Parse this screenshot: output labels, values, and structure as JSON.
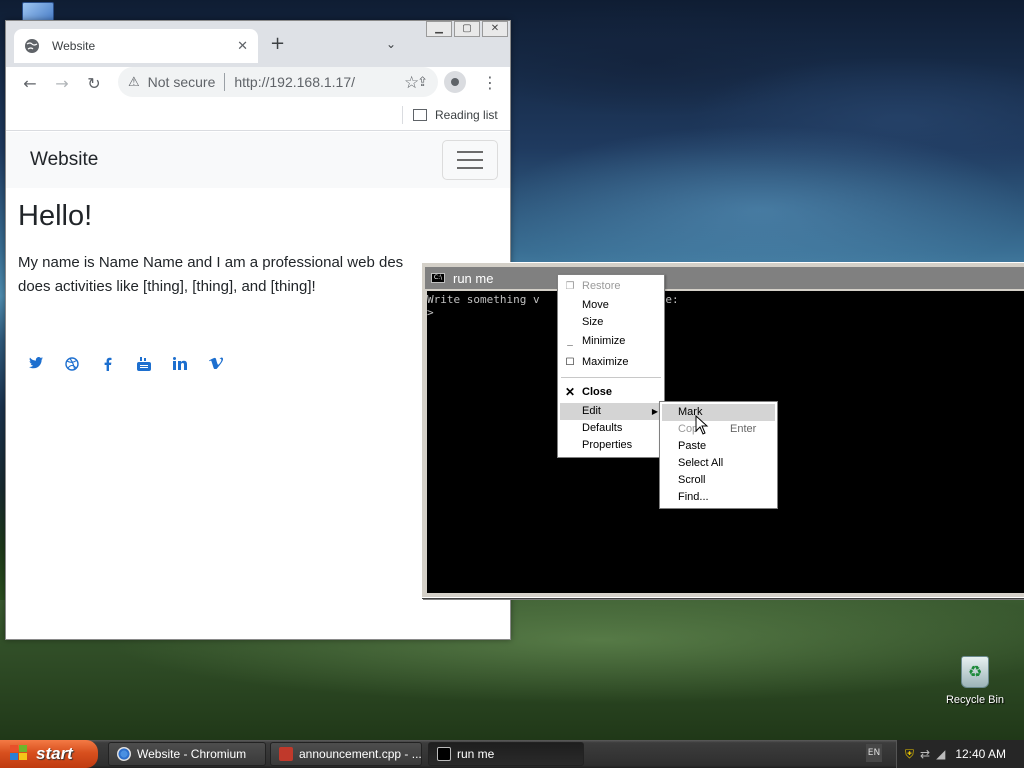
{
  "browser": {
    "tab_title": "Website",
    "security_label": "Not secure",
    "url": "http://192.168.1.17/",
    "reading_list_label": "Reading list"
  },
  "website": {
    "brand": "Website",
    "heading": "Hello!",
    "bio_line1": "My name is Name Name and I am a professional web des",
    "bio_line2": "does activities like [thing], [thing], and [thing]!",
    "social_icons": [
      "twitter-icon",
      "dribbble-icon",
      "facebook-icon",
      "youtube-icon",
      "linkedin-icon",
      "vimeo-icon"
    ]
  },
  "console": {
    "title": "run me",
    "line1": "Write something v        d witty here:",
    "line2": ">"
  },
  "system_menu": {
    "items": [
      {
        "label": "Restore",
        "disabled": true
      },
      {
        "label": "Move"
      },
      {
        "label": "Size"
      },
      {
        "label": "Minimize"
      },
      {
        "label": "Maximize"
      },
      {
        "label": "Close",
        "bold": true
      },
      {
        "label": "Edit",
        "selected": true,
        "submenu": true
      },
      {
        "label": "Defaults"
      },
      {
        "label": "Properties"
      }
    ]
  },
  "edit_submenu": {
    "items": [
      {
        "label": "Mark",
        "selected": true
      },
      {
        "label": "Copy",
        "shortcut": "Enter",
        "disabled": true
      },
      {
        "label": "Paste"
      },
      {
        "label": "Select All"
      },
      {
        "label": "Scroll"
      },
      {
        "label": "Find..."
      }
    ],
    "copy_visible": "Cop"
  },
  "desktop": {
    "recycle_bin_label": "Recycle Bin"
  },
  "taskbar": {
    "start_label": "start",
    "tasks": [
      {
        "label": "Website - Chromium"
      },
      {
        "label": "announcement.cpp - ..."
      },
      {
        "label": "run me"
      }
    ],
    "language": "EN",
    "clock": "12:40 AM"
  },
  "colors": {
    "link_blue": "#1d6fcf",
    "start_orange": "#d8501e",
    "console_bg": "#000000"
  }
}
